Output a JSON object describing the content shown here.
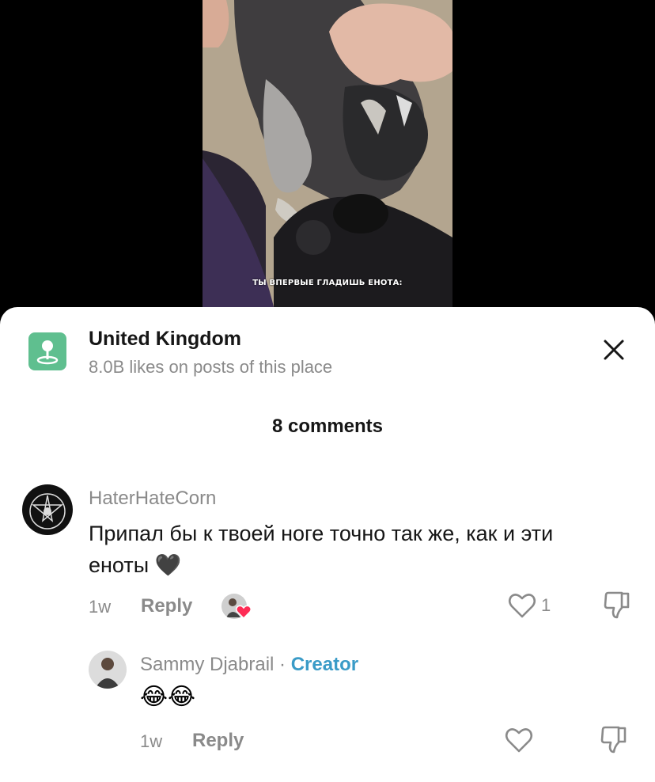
{
  "video": {
    "caption": "ТЫ ВПЕРВЫЕ ГЛАДИШЬ ЕНОТА:"
  },
  "place": {
    "icon": "map-pin-icon",
    "title": "United Kingdom",
    "subtitle": "8.0B likes on posts of this place"
  },
  "comments_header": {
    "count_label": "8 comments"
  },
  "comments": [
    {
      "username": "HaterHateCorn",
      "text_line1": "Припал бы к твоей ноге точно так же, как и эти",
      "text_line2": "еноты 🖤",
      "time": "1w",
      "reply_label": "Reply",
      "like_count": "1",
      "creator_liked": true
    }
  ],
  "reply": {
    "username": "Sammy Djabrail",
    "separator": "·",
    "badge": "Creator",
    "text": "😂😂",
    "time": "1w",
    "reply_label": "Reply"
  },
  "colors": {
    "accent_blue": "#3a9bc7",
    "place_icon_bg": "#5fbf8f",
    "heart_red": "#fe2c55"
  }
}
